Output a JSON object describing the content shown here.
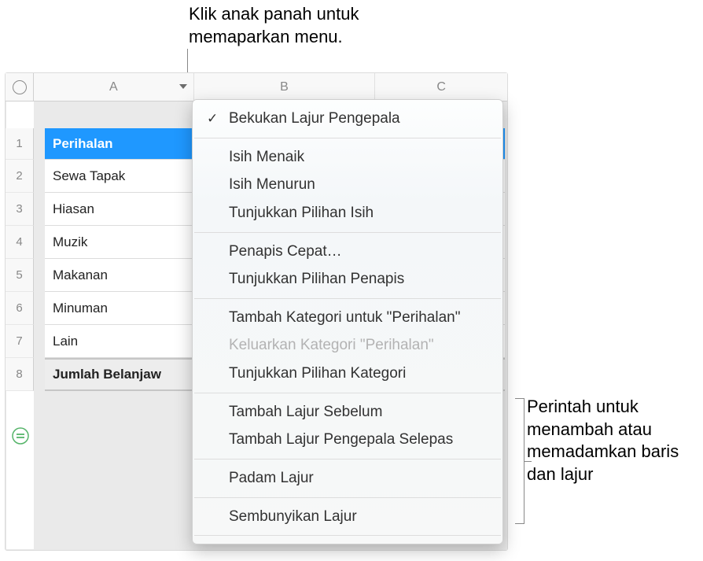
{
  "callouts": {
    "top": "Klik anak panah untuk memaparkan menu.",
    "right": "Perintah untuk menambah atau memadamkan baris dan lajur"
  },
  "columns": [
    "A",
    "B",
    "C"
  ],
  "row_numbers": [
    "1",
    "2",
    "3",
    "4",
    "5",
    "6",
    "7",
    "8"
  ],
  "rows": {
    "header": "Perihalan",
    "data": [
      "Sewa Tapak",
      "Hiasan",
      "Muzik",
      "Makanan",
      "Minuman",
      "Lain"
    ],
    "footer": "Jumlah Belanjaw"
  },
  "menu": {
    "freeze": "Bekukan Lajur Pengepala",
    "sort_asc": "Isih Menaik",
    "sort_desc": "Isih Menurun",
    "sort_options": "Tunjukkan Pilihan Isih",
    "quick_filter": "Penapis Cepat…",
    "filter_options": "Tunjukkan Pilihan Penapis",
    "add_category": "Tambah Kategori untuk \"Perihalan\"",
    "remove_category": "Keluarkan Kategori \"Perihalan\"",
    "category_options": "Tunjukkan Pilihan Kategori",
    "add_col_before": "Tambah Lajur Sebelum",
    "add_col_after": "Tambah Lajur Pengepala Selepas",
    "delete_col": "Padam Lajur",
    "hide_col": "Sembunyikan Lajur"
  },
  "icons": {
    "checkmark": "✓"
  }
}
